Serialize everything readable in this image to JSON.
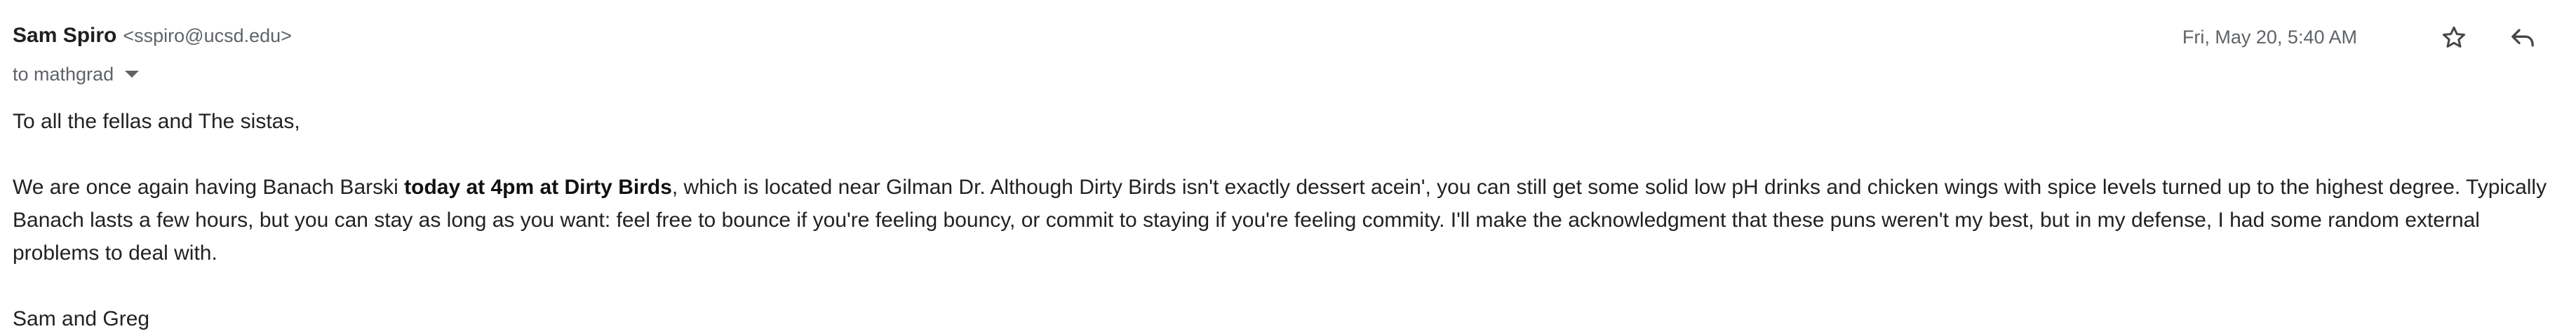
{
  "sender": {
    "name": "Sam Spiro",
    "email": "<sspiro@ucsd.edu>"
  },
  "recipient": {
    "label": "to mathgrad"
  },
  "date": "Fri, May 20, 5:40 AM",
  "icons": {
    "star": "star-icon",
    "reply": "reply-icon",
    "more": "more-vert-icon"
  },
  "body": {
    "greeting": "To all the fellas and The sistas,",
    "para_before_bold": "We are once again having Banach Barski ",
    "para_bold": "today at 4pm at Dirty Birds",
    "para_after_bold": ", which is located near Gilman Dr.  Although Dirty Birds isn't exactly dessert acein', you can still get some solid low pH drinks and chicken wings with spice levels turned up to the highest degree.  Typically Banach lasts a few hours, but you can stay as long as you want: feel free to bounce if you're feeling bouncy, or commit to staying if you're feeling commity.  I'll make the acknowledgment that these puns weren't my best, but in my defense, I had some random external problems to deal with.",
    "signature": "Sam and Greg"
  }
}
